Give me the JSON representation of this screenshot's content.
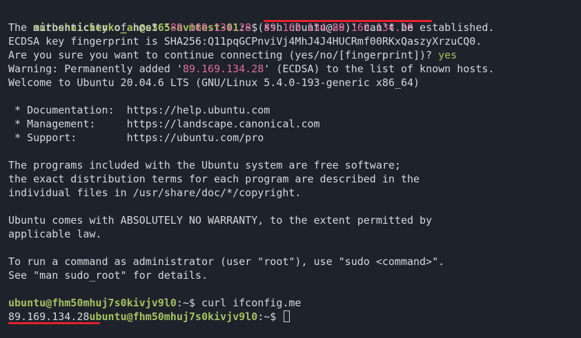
{
  "terminal": {
    "l1": {
      "user": "miroshnichenko_an@e365-avmtest-01",
      "tail": ":~$ ",
      "cmd_a": "ssh ubuntu@",
      "ip": "89.169.134.28"
    },
    "l2": {
      "a": "The authenticity of host '",
      "ip1": "89.169.134.28",
      "b": " (",
      "ip2": "89.169.134.28",
      "c": ")' can't be established."
    },
    "l3": "ECDSA key fingerprint is SHA256:Q11pqGCPnviVj4MhJ4J4HUCRmf00RKxQaszyXrzuCQ0.",
    "l4": {
      "text": "Are you sure you want to continue connecting (yes/no/[fingerprint])? ",
      "answer": "yes"
    },
    "l5": {
      "a": "Warning: Permanently added '",
      "ip": "89.169.134.28",
      "b": "' (ECDSA) to the list of known hosts."
    },
    "l6": "Welcome to Ubuntu 20.04.6 LTS (GNU/Linux 5.4.0-193-generic x86_64)",
    "l7": "",
    "l8": " * Documentation:  https://help.ubuntu.com",
    "l9": " * Management:     https://landscape.canonical.com",
    "l10": " * Support:        https://ubuntu.com/pro",
    "l11": "",
    "l12": "The programs included with the Ubuntu system are free software;",
    "l13": "the exact distribution terms for each program are described in the",
    "l14": "individual files in /usr/share/doc/*/copyright.",
    "l15": "",
    "l16": "Ubuntu comes with ABSOLUTELY NO WARRANTY, to the extent permitted by",
    "l17": "applicable law.",
    "l18": "",
    "l19": "To run a command as administrator (user \"root\"), use \"sudo <command>\".",
    "l20": "See \"man sudo_root\" for details.",
    "l21": "",
    "l22": {
      "user": "ubuntu@fhm50mhuj7s0kivjv9l0",
      "tail": ":~$ ",
      "cmd": "curl ifconfig.me"
    },
    "l23": {
      "ip": "89.169.134.28",
      "user": "ubuntu@fhm50mhuj7s0kivjv9l0",
      "tail": ":~$ "
    }
  },
  "colors": {
    "background": "#1e232b",
    "text": "#d5d8dc",
    "prompt": "#a5c261",
    "ip_highlight": "#e06c9f",
    "annotation_underline": "#e8222e"
  }
}
